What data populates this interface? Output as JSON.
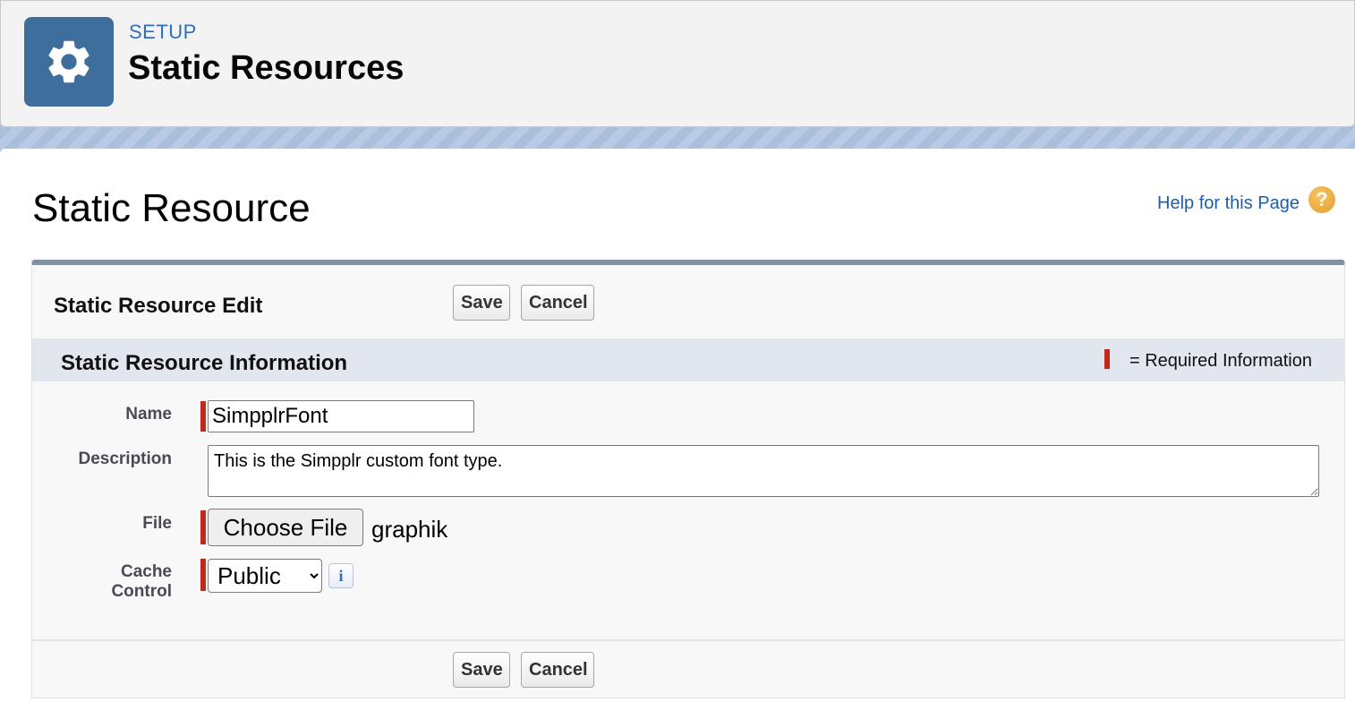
{
  "header": {
    "section_label": "SETUP",
    "title": "Static Resources",
    "icon": "gear-icon"
  },
  "page": {
    "title": "Static Resource",
    "help_link": "Help for this Page",
    "help_icon": "question-icon",
    "help_icon_glyph": "?"
  },
  "panel": {
    "title": "Static Resource Edit",
    "save_label": "Save",
    "cancel_label": "Cancel",
    "section_title": "Static Resource Information",
    "required_legend": "= Required Information"
  },
  "form": {
    "name_label": "Name",
    "name_value": "SimpplrFont",
    "description_label": "Description",
    "description_value": "This is the Simpplr custom font type.",
    "file_label": "File",
    "file_button_label": "Choose File",
    "file_name": "graphik",
    "cache_label_line1": "Cache",
    "cache_label_line2": "Control",
    "cache_selected": "Public",
    "info_glyph": "i"
  },
  "colors": {
    "required_marker": "#c4271b",
    "setup_icon_bg": "#3e6e9c",
    "link": "#1f5da8"
  }
}
